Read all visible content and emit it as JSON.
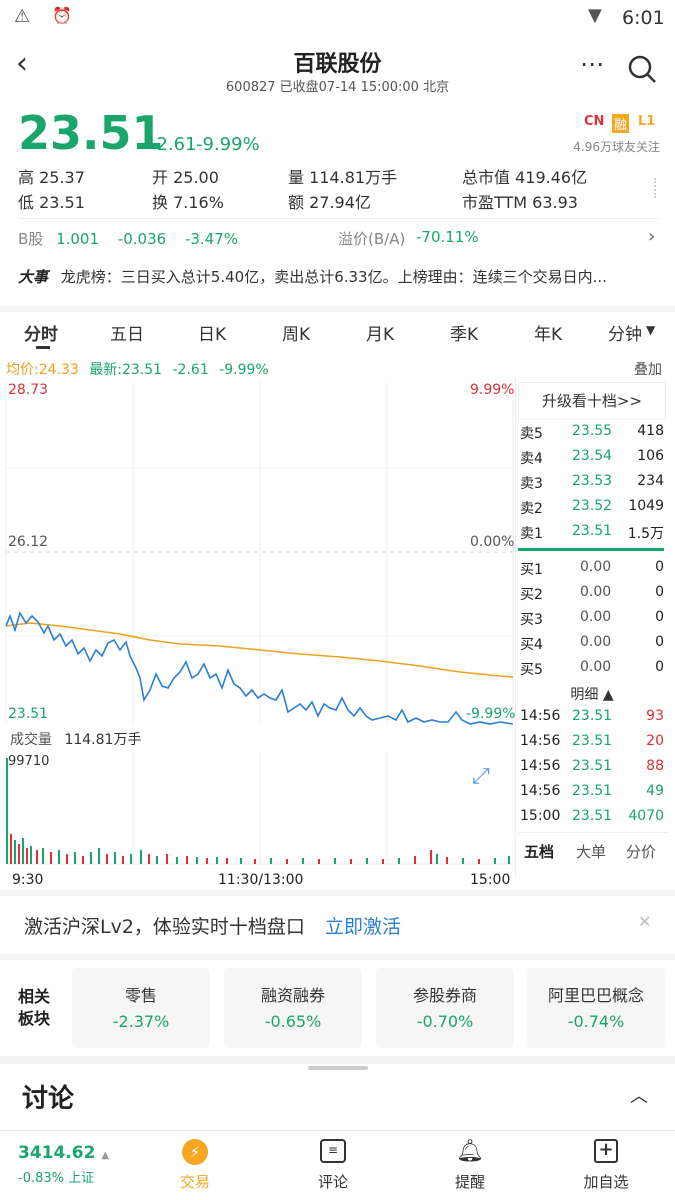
{
  "status_bar": {
    "time": "6:01"
  },
  "header": {
    "title": "百联股份",
    "subtitle": "600827 已收盘07-14 15:00:00 北京"
  },
  "quote": {
    "price": "23.51",
    "change": "-2.61",
    "change_pct": "-9.99%",
    "badges": [
      "CN",
      "融",
      "L1"
    ],
    "followers": "4.96万球友关注",
    "high_label": "高",
    "high": "25.37",
    "low_label": "低",
    "low": "23.51",
    "open_label": "开",
    "open": "25.00",
    "turnover_label": "换",
    "turnover": "7.16%",
    "volume_label": "量",
    "volume": "114.81万手",
    "amount_label": "额",
    "amount": "27.94亿",
    "mktcap_label": "总市值",
    "mktcap": "419.46亿",
    "pe_label": "市盈TTM",
    "pe": "63.93",
    "bshare_label": "B股",
    "bshare_price": "1.001",
    "bshare_change": "-0.036",
    "bshare_pct": "-3.47%",
    "premium_label": "溢价(B/A)",
    "premium": "-70.11%",
    "event_tag": "大事",
    "event_text": "龙虎榜：三日买入总计5.40亿，卖出总计6.33亿。上榜理由：连续三个交易日内..."
  },
  "tabs": [
    "分时",
    "五日",
    "日K",
    "周K",
    "月K",
    "季K",
    "年K",
    "分钟"
  ],
  "chart_info": {
    "avg_label": "均价:24.33",
    "latest_label": "最新:23.51",
    "latest_change": "-2.61",
    "latest_pct": "-9.99%",
    "overlay_label": "叠加",
    "y_top": "28.73",
    "y_top_pct": "9.99%",
    "y_mid": "26.12",
    "y_mid_pct": "0.00%",
    "y_bot": "23.51",
    "y_bot_pct": "-9.99%",
    "vol_label": "成交量",
    "vol_value": "114.81万手",
    "vol_max": "99710",
    "x_labels": [
      "9:30",
      "11:30/13:00",
      "15:00"
    ]
  },
  "order_book": {
    "upgrade_label": "升级看十档>>",
    "asks": [
      {
        "label": "卖5",
        "price": "23.55",
        "qty": "418"
      },
      {
        "label": "卖4",
        "price": "23.54",
        "qty": "106"
      },
      {
        "label": "卖3",
        "price": "23.53",
        "qty": "234"
      },
      {
        "label": "卖2",
        "price": "23.52",
        "qty": "1049"
      },
      {
        "label": "卖1",
        "price": "23.51",
        "qty": "1.5万"
      }
    ],
    "bids": [
      {
        "label": "买1",
        "price": "0.00",
        "qty": "0"
      },
      {
        "label": "买2",
        "price": "0.00",
        "qty": "0"
      },
      {
        "label": "买3",
        "price": "0.00",
        "qty": "0"
      },
      {
        "label": "买4",
        "price": "0.00",
        "qty": "0"
      },
      {
        "label": "买5",
        "price": "0.00",
        "qty": "0"
      }
    ],
    "detail_label": "明细 ▲",
    "ticks": [
      {
        "time": "14:56",
        "price": "23.51",
        "qty": "93"
      },
      {
        "time": "14:56",
        "price": "23.51",
        "qty": "20"
      },
      {
        "time": "14:56",
        "price": "23.51",
        "qty": "88"
      },
      {
        "time": "14:56",
        "price": "23.51",
        "qty": "49"
      },
      {
        "time": "15:00",
        "price": "23.51",
        "qty": "4070"
      }
    ],
    "sub_tabs": [
      "五档",
      "大单",
      "分价"
    ]
  },
  "banner": {
    "text": "激活沪深Lv2，体验实时十档盘口",
    "link": "立即激活"
  },
  "sectors": {
    "label": "相关\n板块",
    "items": [
      {
        "name": "零售",
        "pct": "-2.37%"
      },
      {
        "name": "融资融券",
        "pct": "-0.65%"
      },
      {
        "name": "参股券商",
        "pct": "-0.70%"
      },
      {
        "name": "阿里巴巴概念",
        "pct": "-0.74%"
      }
    ]
  },
  "discuss": {
    "title": "讨论"
  },
  "bottom_nav": {
    "index_value": "3414.62",
    "index_change": "-0.83%",
    "index_name": "上证",
    "items": [
      "交易",
      "评论",
      "提醒",
      "加自选"
    ]
  },
  "colors": {
    "up": "#e0303a",
    "down": "#1aa56a",
    "price_line": "#2a7fd4",
    "avg_line": "#f0a020",
    "accent": "#f5a623"
  }
}
